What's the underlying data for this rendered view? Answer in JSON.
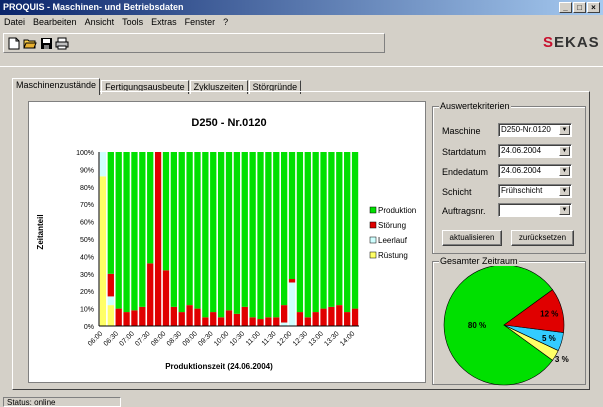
{
  "window": {
    "title": "PROQUIS - Maschinen- und Betriebsdaten",
    "btn_min": "_",
    "btn_max": "□",
    "btn_close": "×"
  },
  "menu": [
    "Datei",
    "Bearbeiten",
    "Ansicht",
    "Tools",
    "Extras",
    "Fenster",
    "?"
  ],
  "toolbar": {
    "icons": [
      "new-file-icon",
      "open-folder-icon",
      "save-icon",
      "print-icon"
    ]
  },
  "logo": {
    "s": "S",
    "rest": "EKAS",
    "accent": "#c8102e"
  },
  "tabs": [
    "Maschinenzustände",
    "Fertigungsausbeute",
    "Zykluszeiten",
    "Störgründe"
  ],
  "chart_data": {
    "type": "bar",
    "title": "D250 - Nr.0120",
    "xlabel": "Produktionszeit (24.06.2004)",
    "ylabel": "Zeitanteil",
    "ylim": [
      0,
      100
    ],
    "yticks": [
      "0%",
      "10%",
      "20%",
      "30%",
      "40%",
      "50%",
      "60%",
      "70%",
      "80%",
      "90%",
      "100%"
    ],
    "xtick_labels": [
      "06:00",
      "06:30",
      "07:00",
      "07:30",
      "08:00",
      "08:30",
      "09:00",
      "09:30",
      "10:00",
      "10:30",
      "11:00",
      "11:30",
      "12:00",
      "12:30",
      "13:00",
      "13:30",
      "14:00"
    ],
    "stack_order": [
      "Rüstung",
      "Leerlauf",
      "Störung",
      "Produktion"
    ],
    "colors": {
      "Produktion": "#00e000",
      "Störung": "#e00000",
      "Leerlauf": "#cfffff",
      "Rüstung": "#ffff66"
    },
    "legend": [
      "Produktion",
      "Störung",
      "Leerlauf",
      "Rüstung"
    ],
    "legend_position": "right",
    "series": [
      {
        "name": "Rüstung",
        "values": [
          86,
          12,
          0,
          0,
          0,
          0,
          0,
          0,
          0,
          0,
          0,
          0,
          0,
          0,
          0,
          0,
          0,
          0,
          0,
          0,
          0,
          0,
          0,
          0,
          0,
          0,
          0,
          0,
          0,
          0,
          0,
          0,
          0
        ]
      },
      {
        "name": "Leerlauf",
        "values": [
          14,
          5,
          0,
          0,
          0,
          0,
          0,
          0,
          0,
          0,
          0,
          0,
          0,
          0,
          0,
          0,
          0,
          0,
          0,
          0,
          0,
          0,
          0,
          2,
          25,
          0,
          0,
          0,
          0,
          0,
          0,
          0,
          0
        ]
      },
      {
        "name": "Störung",
        "values": [
          0,
          13,
          10,
          8,
          9,
          11,
          36,
          100,
          32,
          11,
          8,
          12,
          10,
          5,
          8,
          5,
          9,
          7,
          11,
          5,
          4,
          5,
          5,
          10,
          2,
          8,
          5,
          8,
          10,
          11,
          12,
          8,
          10
        ]
      },
      {
        "name": "Produktion",
        "values": [
          0,
          70,
          90,
          92,
          91,
          89,
          64,
          0,
          68,
          89,
          92,
          88,
          90,
          95,
          92,
          95,
          91,
          93,
          89,
          95,
          96,
          95,
          95,
          88,
          73,
          92,
          95,
          92,
          90,
          89,
          88,
          92,
          90
        ]
      }
    ]
  },
  "criteria": {
    "title": "Auswertekriterien",
    "fields": [
      {
        "label": "Maschine",
        "value": "D250-Nr.0120"
      },
      {
        "label": "Startdatum",
        "value": "24.06.2004"
      },
      {
        "label": "Endedatum",
        "value": "24.06.2004"
      },
      {
        "label": "Schicht",
        "value": "Frühschicht"
      },
      {
        "label": "Auftragsnr.",
        "value": ""
      }
    ],
    "btn_update": "aktualisieren",
    "btn_reset": "zurücksetzen"
  },
  "pie": {
    "title": "Gesamter Zeitraum",
    "slices": [
      {
        "name": "Produktion",
        "value": 80,
        "label": "80 %",
        "color": "#00e000"
      },
      {
        "name": "Störung",
        "value": 12,
        "label": "12 %",
        "color": "#e00000"
      },
      {
        "name": "Leerlauf",
        "value": 5,
        "label": "5 %",
        "color": "#33ccff"
      },
      {
        "name": "Rüstung",
        "value": 3,
        "label": "3 %",
        "color": "#ffff66"
      }
    ]
  },
  "status": "Status: online"
}
